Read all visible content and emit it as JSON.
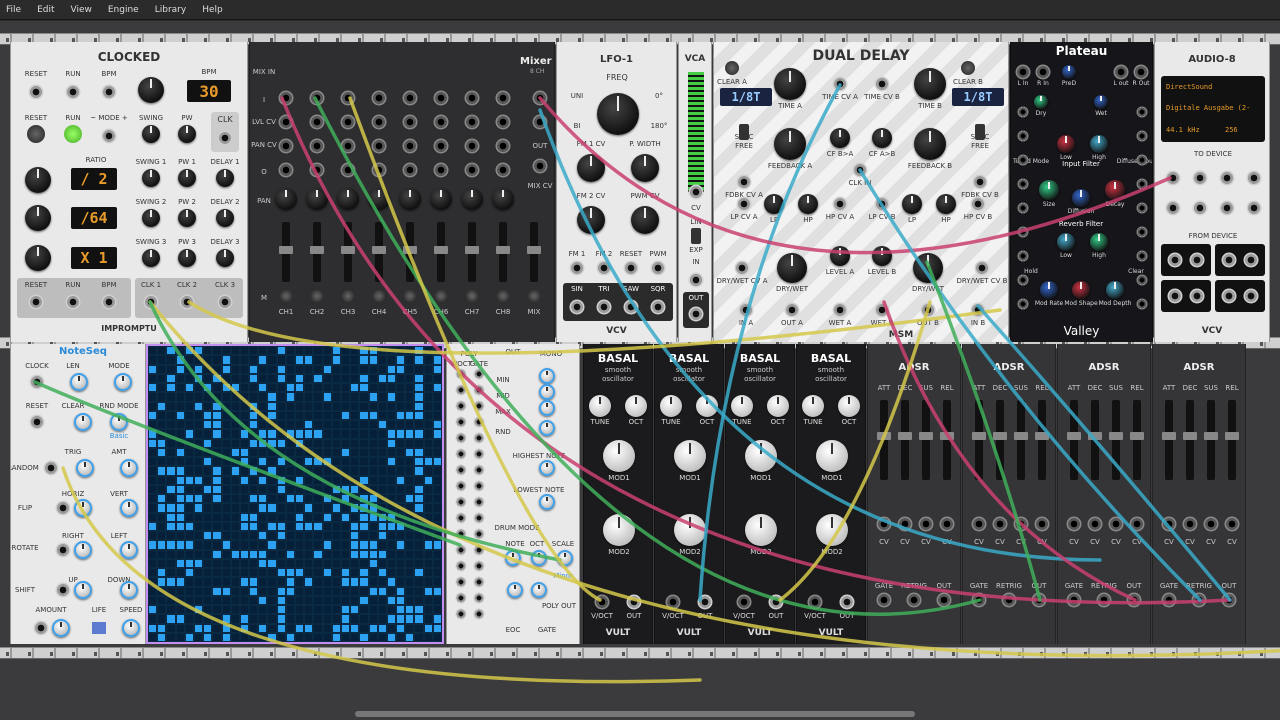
{
  "menu": [
    "File",
    "Edit",
    "View",
    "Engine",
    "Library",
    "Help"
  ],
  "clocked": {
    "title": "CLOCKED",
    "bpm_label": "BPM",
    "bpm_value": "30",
    "labels": [
      "RESET",
      "RUN",
      "BPM",
      "RESET",
      "RUN",
      "~ MODE +",
      "SWING",
      "PW",
      "CLK",
      "RATIO",
      "SWING 1",
      "PW 1",
      "DELAY 1",
      "SWING 2",
      "PW 2",
      "DELAY 2",
      "SWING 3",
      "PW 3",
      "DELAY 3",
      "RESET",
      "RUN",
      "BPM",
      "CLK 1",
      "CLK 2",
      "CLK 3"
    ],
    "displays": [
      "/ 2",
      "/64",
      "X 1"
    ],
    "brand": "IMPROMPTU"
  },
  "mixer": {
    "title": "Mixer",
    "subtitle": "8 CH",
    "labels": [
      "MIX IN",
      "I",
      "LVL CV",
      "PAN CV",
      "O",
      "PAN",
      "M",
      "OUT",
      "MIX CV"
    ],
    "channels": [
      "CH1",
      "CH2",
      "CH3",
      "CH4",
      "CH5",
      "CH6",
      "CH7",
      "CH8",
      "MIX"
    ]
  },
  "lfo": {
    "title": "LFO-1",
    "freq": "FREQ",
    "labels": [
      "UNI",
      "BI",
      "0°",
      "180°",
      "FM 1 CV",
      "P. WIDTH",
      "FM 2 CV",
      "PWM CV",
      "FM 1",
      "FM 2",
      "RESET",
      "PWM",
      "SIN",
      "TRI",
      "SAW",
      "SQR"
    ],
    "brand": "VCV"
  },
  "vca": {
    "title": "VCA",
    "labels": [
      "CV",
      "LIN",
      "EXP",
      "IN",
      "OUT"
    ]
  },
  "delay": {
    "title": "DUAL DELAY",
    "display_a": "1/8T",
    "display_b": "1/8T",
    "labels": [
      "CLEAR A",
      "TIME A",
      "TIME CV A",
      "TIME CV B",
      "TIME B",
      "CLEAR B",
      "SYNC",
      "FREE",
      "FEEDBACK A",
      "CF B>A",
      "CF A>B",
      "FEEDBACK B",
      "SYNC",
      "FREE",
      "FDBK CV A",
      "LP CV A",
      "LP",
      "HP",
      "HP CV A",
      "CLK IN",
      "LP CV B",
      "LP",
      "HP",
      "HP CV B",
      "FDBK CV B",
      "LEVEL A",
      "LEVEL B",
      "DRY/WET CV A",
      "DRY/WET",
      "DRY/WET",
      "DRY/WET CV B",
      "IN A",
      "OUT A",
      "WET A",
      "WET B",
      "OUT B",
      "IN B"
    ],
    "brand": "MSM"
  },
  "plateau": {
    "title": "Plateau",
    "labels": [
      "L In",
      "R In",
      "Short",
      "PreD",
      "Long",
      "L out",
      "R Out",
      "Dry",
      "Wet",
      "Input Filter",
      "Tuned Mode",
      "Low",
      "High",
      "Diffuse Input",
      "Size",
      "Decay",
      "Diffusion",
      "Reverb Filter",
      "Tog.",
      "Low",
      "High",
      "Hold",
      "Clear",
      "Mod Rate",
      "Mod Shape",
      "Mod Depth"
    ],
    "brand": "Valley"
  },
  "audio": {
    "title": "AUDIO-8",
    "driver": "DirectSound",
    "device": "Digitale Ausgabe (2-",
    "rate": "44.1 kHz",
    "block": "256",
    "to_device": "TO DEVICE",
    "from_device": "FROM DEVICE",
    "brand": "VCV"
  },
  "noteseq": {
    "title": "NoteSeq",
    "labels": [
      "CLOCK",
      "LEN",
      "MODE",
      "RESET",
      "CLEAR",
      "RND MODE",
      "Basic",
      "TRIG",
      "AMT",
      "RANDOM",
      "HORIZ",
      "VERT",
      "FLIP",
      "RIGHT",
      "LEFT",
      "ROTATE",
      "UP",
      "DOWN",
      "SHIFT",
      "AMOUNT",
      "LIFE",
      "SPEED"
    ],
    "out_labels": [
      "POLY",
      "OUT",
      "MONO",
      "V/OCT",
      "GATE",
      "MIN",
      "MID",
      "MAX",
      "RND",
      "HIGHEST NOTE",
      "LOWEST NOTE",
      "DRUM MODE",
      "NOTE",
      "OCT",
      "SCALE",
      "Minor",
      "POLY OUT",
      "EOC",
      "GATE"
    ]
  },
  "basal": {
    "title": "BASAL",
    "subtitle1": "smooth",
    "subtitle2": "oscillator",
    "labels": [
      "TUNE",
      "OCT",
      "MOD1",
      "MOD2",
      "V/OCT",
      "OUT"
    ],
    "brand": "VULT"
  },
  "adsr": {
    "title": "ADSR",
    "labels": [
      "ATT",
      "DEC",
      "SUS",
      "REL",
      "CV",
      "CV",
      "CV",
      "CV",
      "GATE",
      "RETRIG",
      "OUT"
    ]
  }
}
